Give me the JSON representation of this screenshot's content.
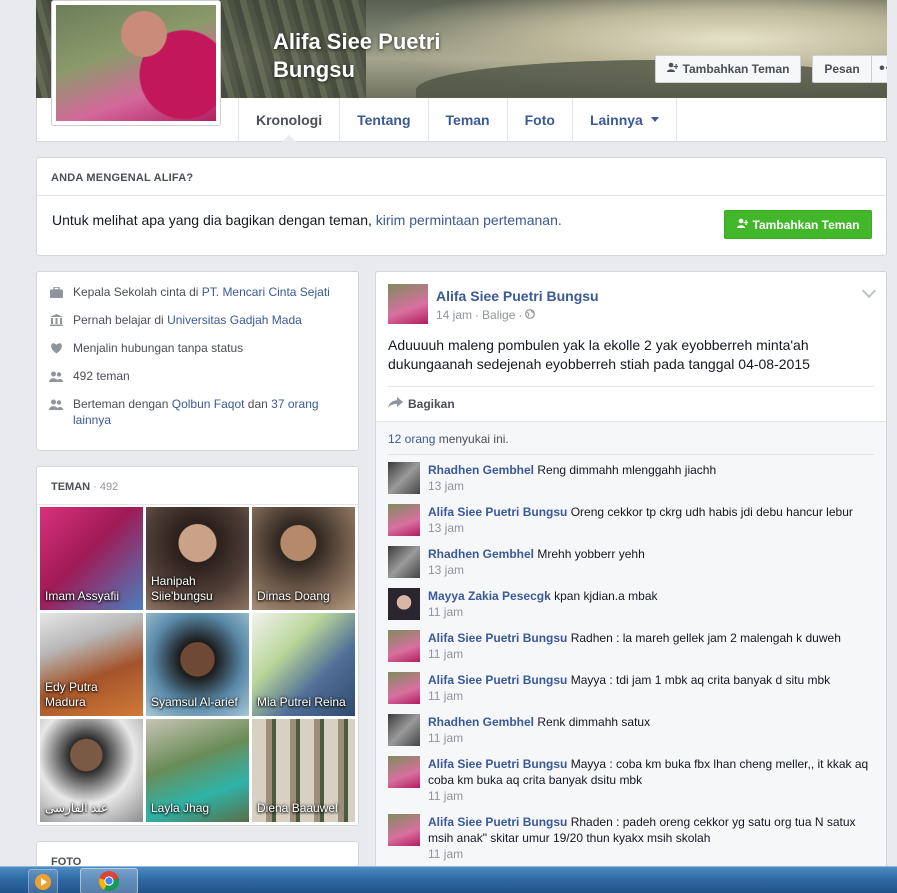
{
  "colors": {
    "link": "#3b5998",
    "green": "#42b72a",
    "page_bg": "#e9eaed"
  },
  "header": {
    "name": "Alifa Siee Puetri Bungsu",
    "add_friend": "Tambahkan Teman",
    "message": "Pesan",
    "more": "•••",
    "tabs": [
      {
        "label": "Kronologi"
      },
      {
        "label": "Tentang"
      },
      {
        "label": "Teman"
      },
      {
        "label": "Foto"
      },
      {
        "label": "Lainnya"
      }
    ]
  },
  "know": {
    "title": "ANDA MENGENAL ALIFA?",
    "text_prefix": "Untuk melihat apa yang dia bagikan dengan teman, ",
    "text_link": "kirim permintaan pertemanan.",
    "button": "Tambahkan Teman"
  },
  "intro": {
    "work_prefix": "Kepala Sekolah cinta di ",
    "work_link": "PT. Mencari Cinta Sejati",
    "edu_prefix": "Pernah belajar di ",
    "edu_link": "Universitas Gadjah Mada",
    "relationship": "Menjalin hubungan tanpa status",
    "friends_count": "492 teman",
    "mutual_prefix": "Berteman dengan ",
    "mutual_link1": "Qolbun Faqot",
    "mutual_mid": " dan ",
    "mutual_link2": "37 orang lainnya"
  },
  "friends": {
    "title": "TEMAN",
    "count": " · 492",
    "items": [
      {
        "name": "Imam Assyafii"
      },
      {
        "name": "Hanipah Siie'bungsu"
      },
      {
        "name": "Dimas Doang"
      },
      {
        "name": "Edy Putra Madura"
      },
      {
        "name": "Syamsul Al-arief"
      },
      {
        "name": "Mia Putrei Reina"
      },
      {
        "name": "عبد الفارسى"
      },
      {
        "name": "Layla Jhag"
      },
      {
        "name": "Diena Baauwel"
      }
    ]
  },
  "photos": {
    "title": "FOTO"
  },
  "post": {
    "author": "Alifa Siee Puetri Bungsu",
    "time": "14 jam",
    "place": "Balige",
    "text": "Aduuuuh maleng pombulen yak la ekolle 2 yak eyobberreh minta'ah dukungaanah sedejenah eyobberreh stiah pada tanggal 04-08-2015",
    "share": "Bagikan",
    "likes_link": "12 orang",
    "likes_suffix": " menyukai ini.",
    "comments": [
      {
        "avatar": "rhaden",
        "name": "Rhadhen Gembhel",
        "text": "Reng dimmahh mlenggahh jiachh",
        "time": "13 jam"
      },
      {
        "avatar": "alifa",
        "name": "Alifa Siee Puetri Bungsu",
        "text": "Oreng cekkor tp ckrg udh habis jdi debu hancur lebur",
        "time": "13 jam"
      },
      {
        "avatar": "rhaden",
        "name": "Rhadhen Gembhel",
        "text": "Mrehh yobberr yehh",
        "time": "13 jam"
      },
      {
        "avatar": "mayya",
        "name": "Mayya Zakia Pesecgk",
        "text": "kpan kjdian.a mbak",
        "time": "11 jam"
      },
      {
        "avatar": "alifa",
        "name": "Alifa Siee Puetri Bungsu",
        "text": "Radhen : la mareh gellek jam 2 malengah k duweh",
        "time": "11 jam"
      },
      {
        "avatar": "alifa",
        "name": "Alifa Siee Puetri Bungsu",
        "text": "Mayya : tdi jam 1 mbk aq crita banyak d situ mbk",
        "time": "11 jam"
      },
      {
        "avatar": "rhaden",
        "name": "Rhadhen Gembhel",
        "text": "Renk dimmahh satux",
        "time": "11 jam"
      },
      {
        "avatar": "alifa",
        "name": "Alifa Siee Puetri Bungsu",
        "text": "Mayya : coba km buka fbx lhan cheng meller,, it kkak aq coba km buka aq crita banyak dsitu mbk",
        "time": "11 jam"
      },
      {
        "avatar": "alifa",
        "name": "Alifa Siee Puetri Bungsu",
        "text": "Rhaden : padeh oreng cekkor yg satu org tua N satux msih anak\" skitar umur 19/20 thun kyakx msih skolah",
        "time": "11 jam"
      }
    ]
  },
  "taskbar": {
    "apps": [
      "media-player-icon",
      "chrome-icon"
    ]
  }
}
